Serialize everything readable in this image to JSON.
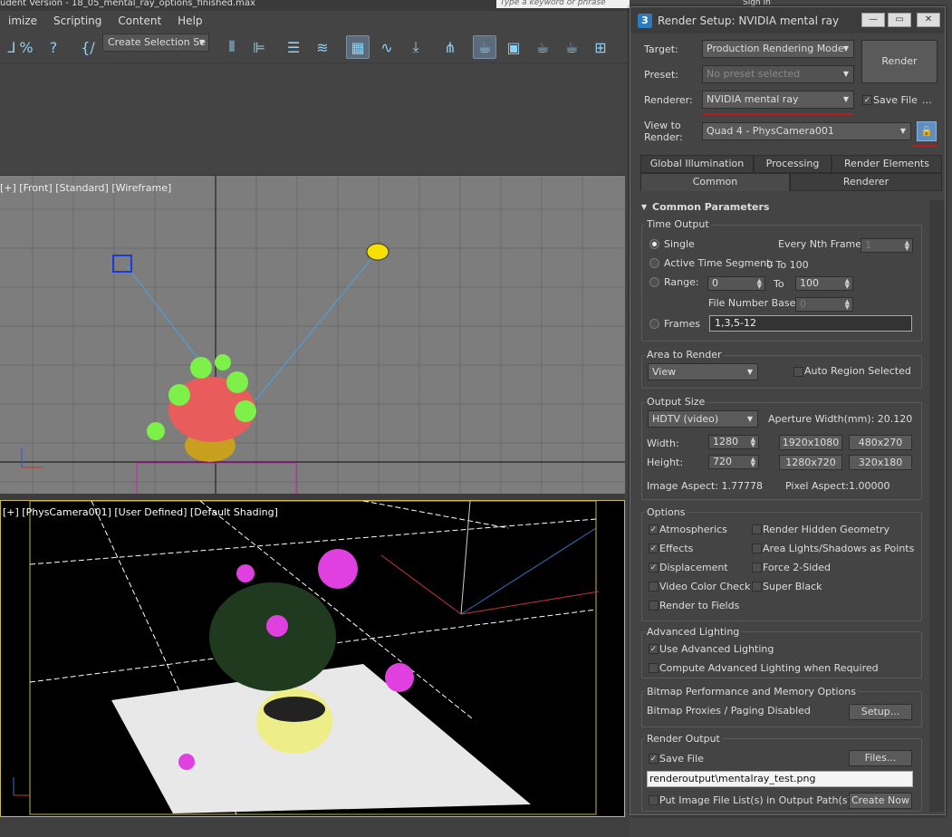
{
  "titlebar": {
    "text": "udent Version - 18_05_mental_ray_options_finished.max",
    "search_placeholder": "Type a keyword or phrase",
    "sign_in": "Sign In"
  },
  "menu": [
    "imize",
    "Scripting",
    "Content",
    "Help"
  ],
  "toolbar": {
    "selection_set": "Create Selection Se"
  },
  "viewports": {
    "front_label": "[+] [Front] [Standard] [Wireframe]",
    "camera_label": "[+] [PhysCamera001] [User Defined] [Default Shading]"
  },
  "dialog": {
    "title": "Render Setup: NVIDIA mental ray",
    "icon_text": "3",
    "target_label": "Target:",
    "target_value": "Production Rendering Mode",
    "preset_label": "Preset:",
    "preset_value": "No preset selected",
    "renderer_label": "Renderer:",
    "renderer_value": "NVIDIA mental ray",
    "save_file_label": "Save File",
    "more_label": "...",
    "view_label_1": "View to",
    "view_label_2": "Render:",
    "view_value": "Quad 4 - PhysCamera001",
    "render_button": "Render",
    "tabs_top": [
      "Global Illumination",
      "Processing",
      "Render Elements"
    ],
    "tabs_bottom": [
      "Common",
      "Renderer"
    ],
    "rollout_title": "Common Parameters",
    "time_output": {
      "title": "Time Output",
      "single": "Single",
      "every_nth": "Every Nth Frame:",
      "every_nth_value": "1",
      "active_segment": "Active Time Segment:",
      "active_segment_value": "0 To 100",
      "range": "Range:",
      "range_from": "0",
      "range_to_label": "To",
      "range_to": "100",
      "file_number_base": "File Number Base:",
      "file_number_base_value": "0",
      "frames": "Frames",
      "frames_value": "1,3,5-12"
    },
    "area": {
      "title": "Area to Render",
      "value": "View",
      "auto_region": "Auto Region Selected"
    },
    "output_size": {
      "title": "Output Size",
      "preset": "HDTV (video)",
      "aperture": "Aperture Width(mm): 20.120",
      "width_label": "Width:",
      "width": "1280",
      "height_label": "Height:",
      "height": "720",
      "presets": [
        "1920x1080",
        "480x270",
        "1280x720",
        "320x180"
      ],
      "image_aspect": "Image Aspect: 1.77778",
      "pixel_aspect_label": "Pixel Aspect:",
      "pixel_aspect": "1.00000"
    },
    "options": {
      "title": "Options",
      "left": [
        {
          "label": "Atmospherics",
          "checked": true
        },
        {
          "label": "Effects",
          "checked": true
        },
        {
          "label": "Displacement",
          "checked": true
        },
        {
          "label": "Video Color Check",
          "checked": false
        },
        {
          "label": "Render to Fields",
          "checked": false
        }
      ],
      "right": [
        {
          "label": "Render Hidden Geometry",
          "checked": false
        },
        {
          "label": "Area Lights/Shadows as Points",
          "checked": false
        },
        {
          "label": "Force 2-Sided",
          "checked": false
        },
        {
          "label": "Super Black",
          "checked": false
        }
      ]
    },
    "advanced_lighting": {
      "title": "Advanced Lighting",
      "use": "Use Advanced Lighting",
      "compute": "Compute Advanced Lighting when Required"
    },
    "bitmap": {
      "title": "Bitmap Performance and Memory Options",
      "status": "Bitmap Proxies / Paging Disabled",
      "setup": "Setup..."
    },
    "render_output": {
      "title": "Render Output",
      "save_file": "Save File",
      "files": "Files...",
      "path": "renderoutput\\mentalray_test.png",
      "put_list": "Put Image File List(s) in Output Path(s)",
      "create_now": "Create Now"
    }
  },
  "colors": {
    "accent_red": "#c0191e",
    "viewport_grid": "#7d7d7d",
    "camera_border": "#c9b94a"
  }
}
